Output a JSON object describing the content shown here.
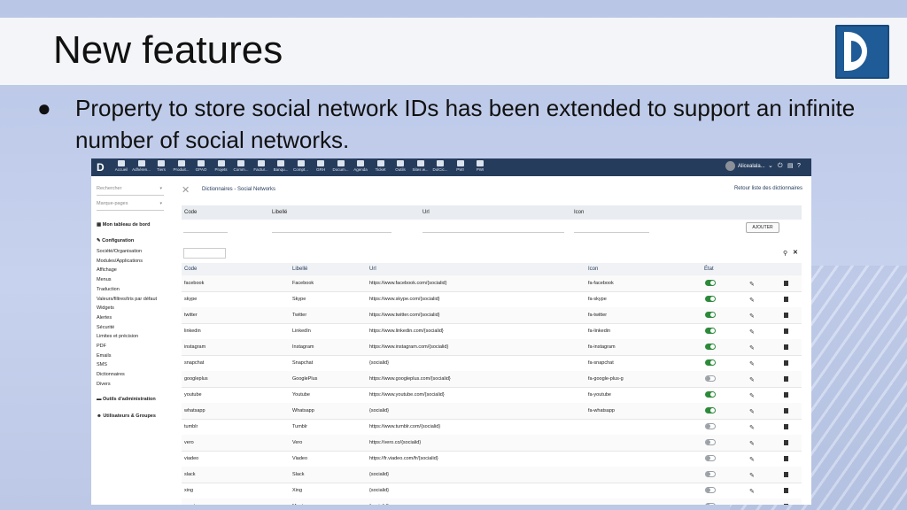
{
  "slide": {
    "title": "New features",
    "bullet": "●",
    "text": "Property to store social network IDs has been extended to support an infinite number of social networks."
  },
  "app": {
    "logo": "D",
    "nav": [
      "Accueil",
      "Adhéren...",
      "Tiers",
      "Produit...",
      "GPAO",
      "Projets",
      "Comm...",
      "Factur...",
      "Banqu...",
      "Compt...",
      "GRH",
      "Docum...",
      "Agenda",
      "Ticket",
      "Outils",
      "Sites w...",
      "DolCic...",
      "PWI",
      "PWI"
    ],
    "user": "Alicealala...",
    "sidebar": {
      "search_placeholder": "Rechercher",
      "bookmarks_placeholder": "Marque-pages",
      "dashboard": "Mon tableau de bord",
      "config_head": "Configuration",
      "links": [
        "Société/Organisation",
        "Modules/Applications",
        "Affichage",
        "Menus",
        "Traduction",
        "Valeurs/filtres/tris par défaut",
        "Widgets",
        "Alertes",
        "Sécurité",
        "Limites et précision",
        "PDF",
        "Emails",
        "SMS",
        "Dictionnaires",
        "Divers"
      ],
      "admin_tools": "Outils d'administration",
      "users_groups": "Utilisateurs & Groupes"
    },
    "breadcrumb": "Dictionnaires - Social Networks",
    "back_link": "Retour liste des dictionnaires",
    "filter_headers": [
      "Code",
      "Libellé",
      "Url",
      "Icon"
    ],
    "add_button": "AJOUTER",
    "table_headers": [
      "Code",
      "Libellé",
      "Url",
      "Icon",
      "État"
    ],
    "rows": [
      {
        "code": "facebook",
        "label": "Facebook",
        "url": "https://www.facebook.com/{socialid}",
        "icon": "fa-facebook",
        "active": true
      },
      {
        "code": "skype",
        "label": "Skype",
        "url": "https://www.skype.com/{socialid}",
        "icon": "fa-skype",
        "active": true
      },
      {
        "code": "twitter",
        "label": "Twitter",
        "url": "https://www.twitter.com/{socialid}",
        "icon": "fa-twitter",
        "active": true
      },
      {
        "code": "linkedin",
        "label": "LinkedIn",
        "url": "https://www.linkedin.com/{socialid}",
        "icon": "fa-linkedin",
        "active": true
      },
      {
        "code": "instagram",
        "label": "Instagram",
        "url": "https://www.instagram.com/{socialid}",
        "icon": "fa-instagram",
        "active": true
      },
      {
        "code": "snapchat",
        "label": "Snapchat",
        "url": "{socialid}",
        "icon": "fa-snapchat",
        "active": true
      },
      {
        "code": "googleplus",
        "label": "GooglePlus",
        "url": "https://www.googleplus.com/{socialid}",
        "icon": "fa-google-plus-g",
        "active": false
      },
      {
        "code": "youtube",
        "label": "Youtube",
        "url": "https://www.youtube.com/{socialid}",
        "icon": "fa-youtube",
        "active": true
      },
      {
        "code": "whatsapp",
        "label": "Whatsapp",
        "url": "{socialid}",
        "icon": "fa-whatsapp",
        "active": true
      },
      {
        "code": "tumblr",
        "label": "Tumblr",
        "url": "https://www.tumblr.com/{socialid}",
        "icon": "",
        "active": false
      },
      {
        "code": "vero",
        "label": "Vero",
        "url": "https://vero.co/{socialid}",
        "icon": "",
        "active": false
      },
      {
        "code": "viadeo",
        "label": "Viadeo",
        "url": "https://fr.viadeo.com/fr/{socialid}",
        "icon": "",
        "active": false
      },
      {
        "code": "slack",
        "label": "Slack",
        "url": "{socialid}",
        "icon": "",
        "active": false
      },
      {
        "code": "xing",
        "label": "Xing",
        "url": "{socialid}",
        "icon": "",
        "active": false
      },
      {
        "code": "meetup",
        "label": "Meetup",
        "url": "{socialid}",
        "icon": "",
        "active": false
      }
    ],
    "colors": {
      "navbar": "#263c5c",
      "toggle_on": "#2c8a3a",
      "link": "#263c5c"
    }
  }
}
